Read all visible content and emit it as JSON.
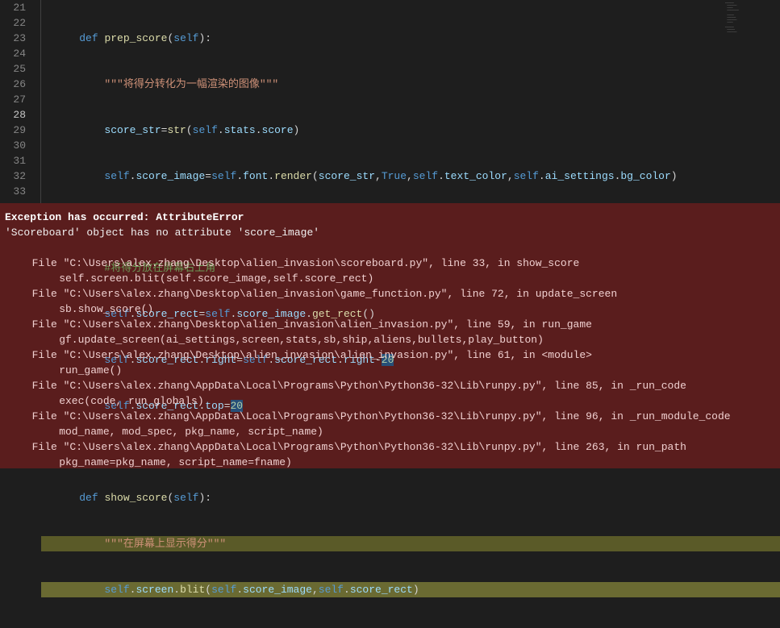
{
  "gutter": {
    "start": 21,
    "end": 33,
    "active": 28,
    "breakpoint": 33
  },
  "code": {
    "l21_kw": "def",
    "l21_fn": "prep_score",
    "l21_self": "self",
    "l22_ds": "\"\"\"将得分转化为一幅渲染的图像\"\"\"",
    "l23_id1": "score_str",
    "l23_fn": "str",
    "l23_self": "self",
    "l23_id2": "stats",
    "l23_id3": "score",
    "l24_self1": "self",
    "l24_id1": "score_image",
    "l24_self2": "self",
    "l24_id2": "font",
    "l24_fn": "render",
    "l24_arg1": "score_str",
    "l24_true": "True",
    "l24_self3": "self",
    "l24_id3": "text_color",
    "l24_self4": "self",
    "l24_id4": "ai_settings",
    "l24_id5": "bg_color",
    "l26_cm": "#将得分放在屏幕右上角",
    "l27_self1": "self",
    "l27_id1": "score_rect",
    "l27_self2": "self",
    "l27_id2": "score_image",
    "l27_fn": "get_rect",
    "l28_self1": "self",
    "l28_id1": "score_rect",
    "l28_id2": "right",
    "l28_self2": "self",
    "l28_id3": "score_rect",
    "l28_id4": "right",
    "l28_num": "20",
    "l29_self": "self",
    "l29_id1": "score_rect",
    "l29_id2": "top",
    "l29_num": "20",
    "l31_kw": "def",
    "l31_fn": "show_score",
    "l31_self": "self",
    "l32_ds": "\"\"\"在屏幕上显示得分\"\"\"",
    "l33_self1": "self",
    "l33_id1": "screen",
    "l33_fn": "blit",
    "l33_self2": "self",
    "l33_id2": "score_image",
    "l33_self3": "self",
    "l33_id3": "score_rect"
  },
  "error": {
    "title": "Exception has occurred: AttributeError",
    "message": "'Scoreboard' object has no attribute 'score_image'",
    "frames": [
      {
        "loc": "  File \"C:\\Users\\alex.zhang\\Desktop\\alien_invasion\\scoreboard.py\", line 33, in show_score",
        "src": "    self.screen.blit(self.score_image,self.score_rect)"
      },
      {
        "loc": "  File \"C:\\Users\\alex.zhang\\Desktop\\alien_invasion\\game_function.py\", line 72, in update_screen",
        "src": "    sb.show_score()"
      },
      {
        "loc": "  File \"C:\\Users\\alex.zhang\\Desktop\\alien_invasion\\alien_invasion.py\", line 59, in run_game",
        "src": "    gf.update_screen(ai_settings,screen,stats,sb,ship,aliens,bullets,play_button)"
      },
      {
        "loc": "  File \"C:\\Users\\alex.zhang\\Desktop\\alien_invasion\\alien_invasion.py\", line 61, in <module>",
        "src": "    run_game()"
      },
      {
        "loc": "  File \"C:\\Users\\alex.zhang\\AppData\\Local\\Programs\\Python\\Python36-32\\Lib\\runpy.py\", line 85, in _run_code",
        "src": "    exec(code, run_globals)"
      },
      {
        "loc": "  File \"C:\\Users\\alex.zhang\\AppData\\Local\\Programs\\Python\\Python36-32\\Lib\\runpy.py\", line 96, in _run_module_code",
        "src": "    mod_name, mod_spec, pkg_name, script_name)"
      },
      {
        "loc": "  File \"C:\\Users\\alex.zhang\\AppData\\Local\\Programs\\Python\\Python36-32\\Lib\\runpy.py\", line 263, in run_path",
        "src": "    pkg_name=pkg_name, script_name=fname)"
      }
    ]
  }
}
